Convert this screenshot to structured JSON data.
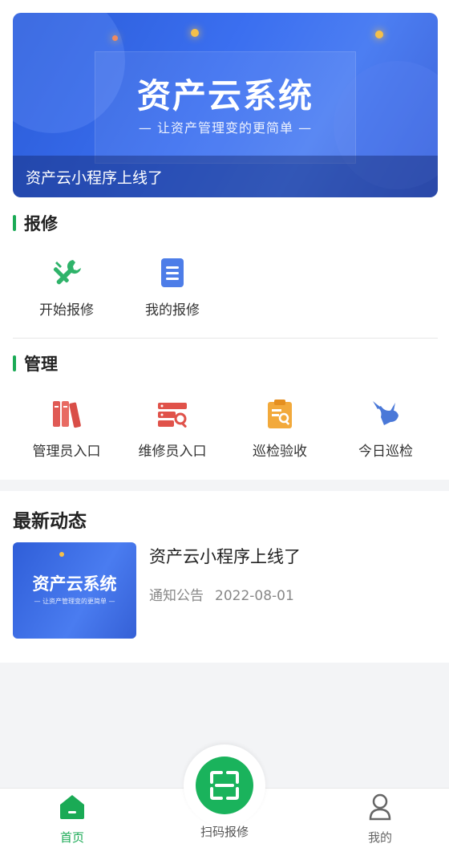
{
  "banner": {
    "title": "资产云系统",
    "subtitle": "— 让资产管理变的更简单 —",
    "caption": "资产云小程序上线了"
  },
  "repair": {
    "title": "报修",
    "items": [
      {
        "label": "开始报修",
        "icon": "wrench-screwdriver-icon"
      },
      {
        "label": "我的报修",
        "icon": "document-icon"
      }
    ]
  },
  "manage": {
    "title": "管理",
    "items": [
      {
        "label": "管理员入口",
        "icon": "books-icon"
      },
      {
        "label": "维修员入口",
        "icon": "server-search-icon"
      },
      {
        "label": "巡检验收",
        "icon": "clipboard-check-icon"
      },
      {
        "label": "今日巡检",
        "icon": "bull-icon"
      }
    ]
  },
  "news": {
    "title": "最新动态",
    "items": [
      {
        "title": "资产云小程序上线了",
        "category": "通知公告",
        "date": "2022-08-01",
        "thumb_title": "资产云系统",
        "thumb_subtitle": "— 让资产管理变的更简单 —"
      }
    ]
  },
  "tabbar": {
    "home": "首页",
    "scan": "扫码报修",
    "mine": "我的"
  },
  "colors": {
    "accent": "#1aaa55",
    "banner_blue": "#3b6ff0",
    "repair_green": "#2fb36a",
    "doc_blue": "#4d7de8",
    "books_red": "#e05a55",
    "server_red": "#e0524a",
    "clipboard_orange": "#f2a93b",
    "bull_blue": "#4a78d8"
  }
}
